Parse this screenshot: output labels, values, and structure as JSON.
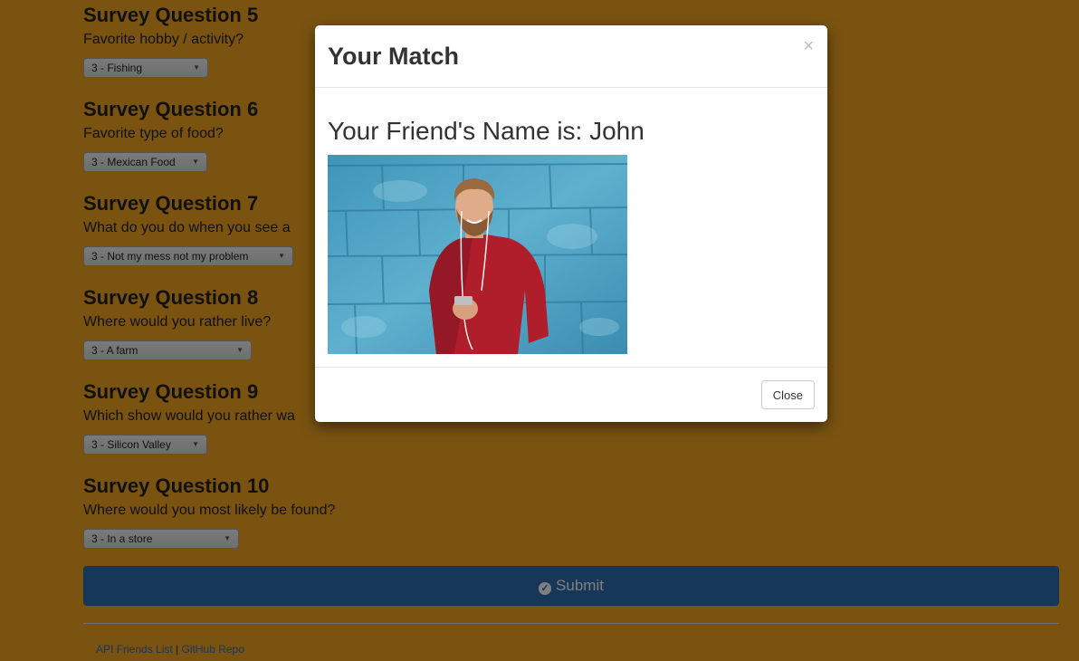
{
  "survey": {
    "questions": [
      {
        "title": "Survey Question 5",
        "text": "Favorite hobby / activity?",
        "selected": "3 - Fishing"
      },
      {
        "title": "Survey Question 6",
        "text": "Favorite type of food?",
        "selected": "3 - Mexican Food"
      },
      {
        "title": "Survey Question 7",
        "text": "What do you do when you see a",
        "selected": "3 - Not my mess not my problem"
      },
      {
        "title": "Survey Question 8",
        "text": "Where would you rather live?",
        "selected": "3 - A farm"
      },
      {
        "title": "Survey Question 9",
        "text": "Which show would you rather wa",
        "selected": "3 - Silicon Valley"
      },
      {
        "title": "Survey Question 10",
        "text": "Where would you most likely be found?",
        "selected": "3 - In a store"
      }
    ],
    "submit_label": "Submit",
    "submit_icon": "check-circle-icon"
  },
  "footer": {
    "link1": "API Friends List",
    "separator": "|",
    "link2": "GitHub Repo"
  },
  "modal": {
    "title": "Your Match",
    "close_symbol": "×",
    "friend_name": "Your Friend's Name is: John",
    "photo_description": "man in red sweater with earphones against blue wall",
    "close_label": "Close"
  },
  "colors": {
    "page_background": "#f5a623",
    "submit_button": "#2f6fb3"
  }
}
